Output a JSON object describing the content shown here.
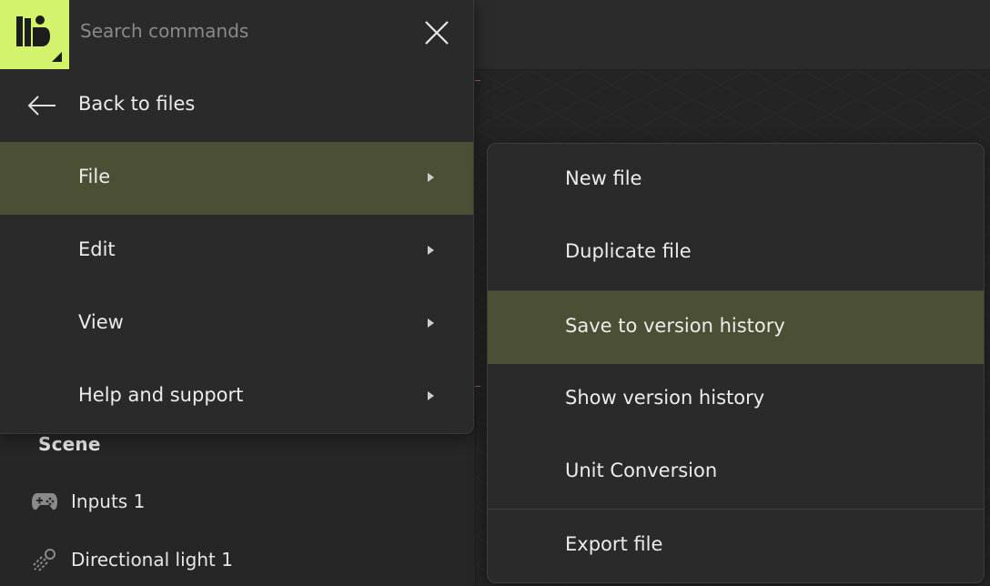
{
  "command_menu": {
    "search": {
      "placeholder": "Search commands"
    },
    "back_label": "Back to files",
    "items": [
      {
        "label": "File"
      },
      {
        "label": "Edit"
      },
      {
        "label": "View"
      },
      {
        "label": "Help and support"
      }
    ]
  },
  "file_submenu": {
    "items": [
      {
        "label": "New file"
      },
      {
        "label": "Duplicate file"
      },
      {
        "label": "Save to version history"
      },
      {
        "label": "Show version history"
      },
      {
        "label": "Unit Conversion"
      },
      {
        "label": "Export file"
      }
    ]
  },
  "scene_panel": {
    "title": "Scene",
    "items": [
      {
        "label": "Inputs 1",
        "icon": "gamepad-icon"
      },
      {
        "label": "Directional light 1",
        "icon": "directional-light-icon"
      }
    ]
  },
  "colors": {
    "logo": "#d2f36b",
    "active_row": "#4b5034",
    "menu_bg": "#2a2a2a"
  }
}
